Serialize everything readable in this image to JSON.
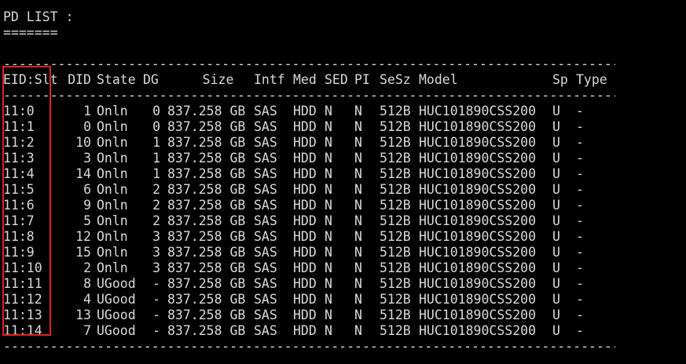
{
  "terminal": {
    "title": "PD LIST :",
    "title_underline": "=======",
    "separator": "---------------------------------------------------------------------------------------------------",
    "highlight_color": "#e02020",
    "text_color": "#d8d8d8",
    "background_color": "#000000"
  },
  "table": {
    "headers": {
      "eid": "EID:Slt",
      "did": "DID",
      "state": "State",
      "dg": "DG",
      "size": "     Size",
      "intf": "Intf",
      "med": "Med",
      "sed": "SED",
      "pi": "PI",
      "sesz": "SeSz",
      "model": "Model",
      "sp": "Sp",
      "type": "Type"
    },
    "rows": [
      {
        "eid": "11:0",
        "did": "1",
        "state": "Onln",
        "dg": "0",
        "size": "837.258 GB",
        "intf": "SAS",
        "med": "HDD",
        "sed": "N",
        "pi": "N",
        "sesz": "512B",
        "model": "HUC101890CSS200",
        "sp": "U",
        "type": "-"
      },
      {
        "eid": "11:1",
        "did": "0",
        "state": "Onln",
        "dg": "0",
        "size": "837.258 GB",
        "intf": "SAS",
        "med": "HDD",
        "sed": "N",
        "pi": "N",
        "sesz": "512B",
        "model": "HUC101890CSS200",
        "sp": "U",
        "type": "-"
      },
      {
        "eid": "11:2",
        "did": "10",
        "state": "Onln",
        "dg": "1",
        "size": "837.258 GB",
        "intf": "SAS",
        "med": "HDD",
        "sed": "N",
        "pi": "N",
        "sesz": "512B",
        "model": "HUC101890CSS200",
        "sp": "U",
        "type": "-"
      },
      {
        "eid": "11:3",
        "did": "3",
        "state": "Onln",
        "dg": "1",
        "size": "837.258 GB",
        "intf": "SAS",
        "med": "HDD",
        "sed": "N",
        "pi": "N",
        "sesz": "512B",
        "model": "HUC101890CSS200",
        "sp": "U",
        "type": "-"
      },
      {
        "eid": "11:4",
        "did": "14",
        "state": "Onln",
        "dg": "1",
        "size": "837.258 GB",
        "intf": "SAS",
        "med": "HDD",
        "sed": "N",
        "pi": "N",
        "sesz": "512B",
        "model": "HUC101890CSS200",
        "sp": "U",
        "type": "-"
      },
      {
        "eid": "11:5",
        "did": "6",
        "state": "Onln",
        "dg": "2",
        "size": "837.258 GB",
        "intf": "SAS",
        "med": "HDD",
        "sed": "N",
        "pi": "N",
        "sesz": "512B",
        "model": "HUC101890CSS200",
        "sp": "U",
        "type": "-"
      },
      {
        "eid": "11:6",
        "did": "9",
        "state": "Onln",
        "dg": "2",
        "size": "837.258 GB",
        "intf": "SAS",
        "med": "HDD",
        "sed": "N",
        "pi": "N",
        "sesz": "512B",
        "model": "HUC101890CSS200",
        "sp": "U",
        "type": "-"
      },
      {
        "eid": "11:7",
        "did": "5",
        "state": "Onln",
        "dg": "2",
        "size": "837.258 GB",
        "intf": "SAS",
        "med": "HDD",
        "sed": "N",
        "pi": "N",
        "sesz": "512B",
        "model": "HUC101890CSS200",
        "sp": "U",
        "type": "-"
      },
      {
        "eid": "11:8",
        "did": "12",
        "state": "Onln",
        "dg": "3",
        "size": "837.258 GB",
        "intf": "SAS",
        "med": "HDD",
        "sed": "N",
        "pi": "N",
        "sesz": "512B",
        "model": "HUC101890CSS200",
        "sp": "U",
        "type": "-"
      },
      {
        "eid": "11:9",
        "did": "15",
        "state": "Onln",
        "dg": "3",
        "size": "837.258 GB",
        "intf": "SAS",
        "med": "HDD",
        "sed": "N",
        "pi": "N",
        "sesz": "512B",
        "model": "HUC101890CSS200",
        "sp": "U",
        "type": "-"
      },
      {
        "eid": "11:10",
        "did": "2",
        "state": "Onln",
        "dg": "3",
        "size": "837.258 GB",
        "intf": "SAS",
        "med": "HDD",
        "sed": "N",
        "pi": "N",
        "sesz": "512B",
        "model": "HUC101890CSS200",
        "sp": "U",
        "type": "-"
      },
      {
        "eid": "11:11",
        "did": "8",
        "state": "UGood",
        "dg": "-",
        "size": "837.258 GB",
        "intf": "SAS",
        "med": "HDD",
        "sed": "N",
        "pi": "N",
        "sesz": "512B",
        "model": "HUC101890CSS200",
        "sp": "U",
        "type": "-"
      },
      {
        "eid": "11:12",
        "did": "4",
        "state": "UGood",
        "dg": "-",
        "size": "837.258 GB",
        "intf": "SAS",
        "med": "HDD",
        "sed": "N",
        "pi": "N",
        "sesz": "512B",
        "model": "HUC101890CSS200",
        "sp": "U",
        "type": "-"
      },
      {
        "eid": "11:13",
        "did": "13",
        "state": "UGood",
        "dg": "-",
        "size": "837.258 GB",
        "intf": "SAS",
        "med": "HDD",
        "sed": "N",
        "pi": "N",
        "sesz": "512B",
        "model": "HUC101890CSS200",
        "sp": "U",
        "type": "-"
      },
      {
        "eid": "11:14",
        "did": "7",
        "state": "UGood",
        "dg": "-",
        "size": "837.258 GB",
        "intf": "SAS",
        "med": "HDD",
        "sed": "N",
        "pi": "N",
        "sesz": "512B",
        "model": "HUC101890CSS200",
        "sp": "U",
        "type": "-"
      }
    ]
  }
}
